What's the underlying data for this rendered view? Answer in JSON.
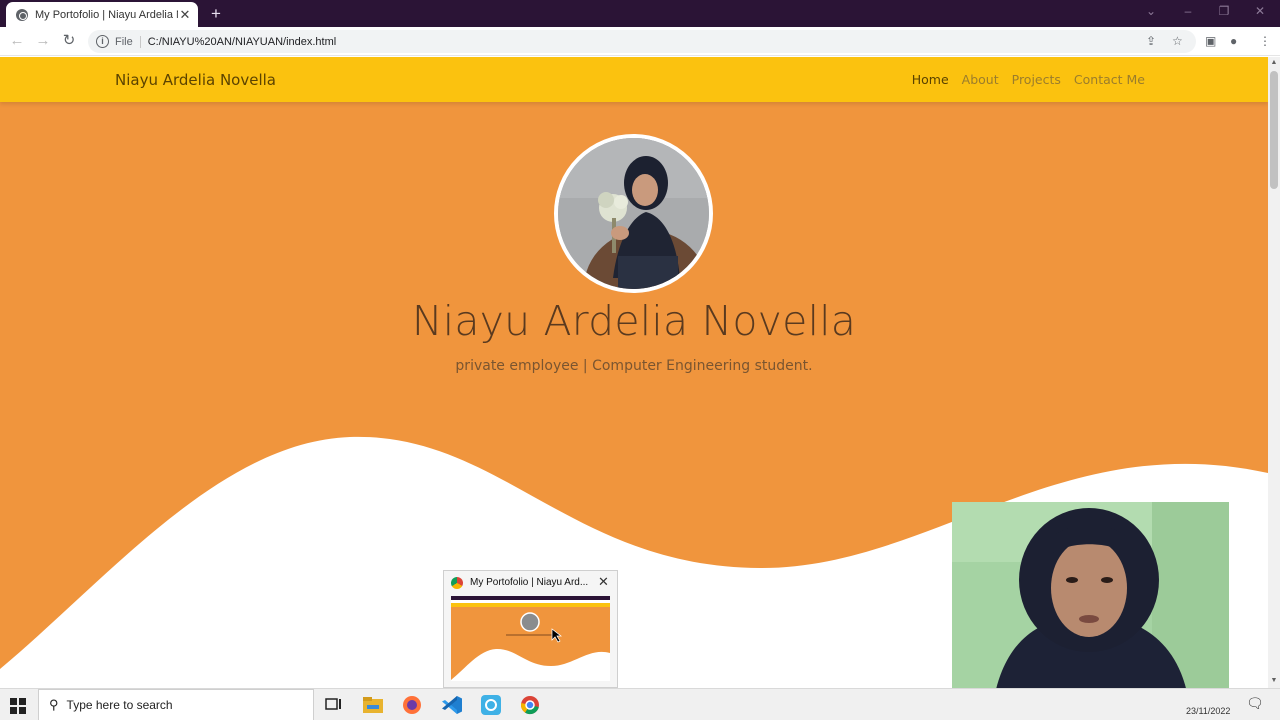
{
  "browser": {
    "tab_title": "My Portofolio | Niayu Ardelia No",
    "new_tab_label": "+",
    "url_scheme": "File",
    "url": "C:/NIAYU%20AN/NIAYUAN/index.html",
    "icons": [
      "back-icon",
      "forward-icon",
      "reload-icon",
      "info-icon",
      "share-icon",
      "star-icon",
      "side-panel-icon",
      "profile-icon",
      "menu-icon"
    ]
  },
  "site": {
    "brand": "Niayu Ardelia Novella",
    "nav": [
      {
        "label": "Home",
        "active": true
      },
      {
        "label": "About",
        "active": false
      },
      {
        "label": "Projects",
        "active": false
      },
      {
        "label": "Contact Me",
        "active": false
      }
    ],
    "hero": {
      "name": "Niayu Ardelia Novella",
      "subtitle": "private employee | Computer Engineering student."
    },
    "colors": {
      "navbar": "#fbc20f",
      "hero": "#f0953d",
      "wave": "#ffffff"
    }
  },
  "preview": {
    "title": "My Portofolio | Niayu Ard...",
    "close": "✕"
  },
  "taskbar": {
    "search_placeholder": "Type here to search",
    "date": "23/11/2022",
    "apps": [
      "task-view-icon",
      "file-explorer-icon",
      "firefox-icon",
      "vscode-icon",
      "app-icon",
      "chrome-icon"
    ]
  }
}
